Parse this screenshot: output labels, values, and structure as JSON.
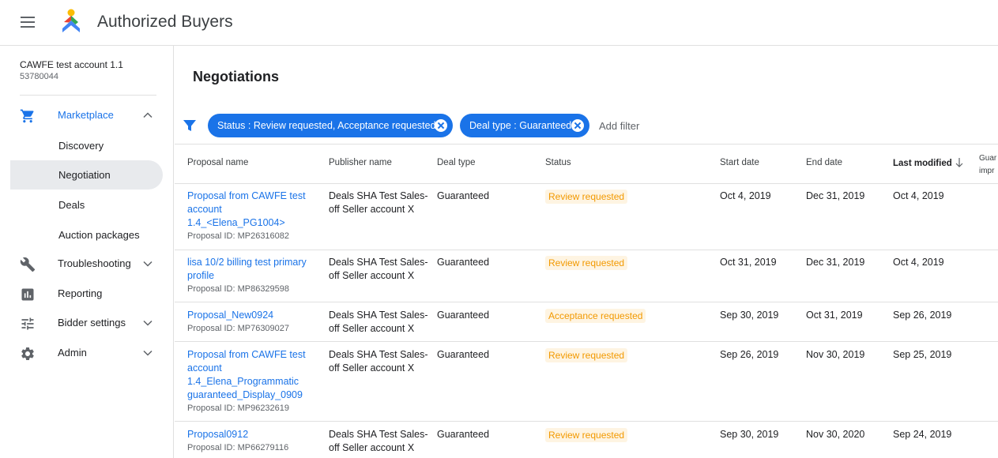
{
  "header": {
    "app_title": "Authorized Buyers"
  },
  "account": {
    "name": "CAWFE test account 1.1",
    "id": "53780044"
  },
  "nav": {
    "marketplace": "Marketplace",
    "discovery": "Discovery",
    "negotiation": "Negotiation",
    "deals": "Deals",
    "auction_packages": "Auction packages",
    "troubleshooting": "Troubleshooting",
    "reporting": "Reporting",
    "bidder_settings": "Bidder settings",
    "admin": "Admin"
  },
  "page": {
    "title": "Negotiations"
  },
  "filters": {
    "chips": [
      "Status : Review requested, Acceptance requested",
      "Deal type : Guaranteed"
    ],
    "add_filter": "Add filter"
  },
  "table": {
    "columns": {
      "proposal_name": "Proposal name",
      "publisher_name": "Publisher name",
      "deal_type": "Deal type",
      "status": "Status",
      "start_date": "Start date",
      "end_date": "End date",
      "last_modified": "Last modified",
      "guaranteed_impressions": "Guar impr"
    },
    "rows": [
      {
        "name_lines": [
          "Proposal from CAWFE test",
          "account",
          "1.4_<Elena_PG1004>"
        ],
        "proposal_id": "Proposal ID: MP26316082",
        "publisher_lines": [
          "Deals SHA Test Sales-",
          "off Seller account X"
        ],
        "deal_type": "Guaranteed",
        "status": "Review requested",
        "start_date": "Oct 4, 2019",
        "end_date": "Dec 31, 2019",
        "last_modified": "Oct 4, 2019"
      },
      {
        "name_lines": [
          "lisa 10/2 billing test primary",
          "profile"
        ],
        "proposal_id": "Proposal ID: MP86329598",
        "publisher_lines": [
          "Deals SHA Test Sales-",
          "off Seller account X"
        ],
        "deal_type": "Guaranteed",
        "status": "Review requested",
        "start_date": "Oct 31, 2019",
        "end_date": "Dec 31, 2019",
        "last_modified": "Oct 4, 2019"
      },
      {
        "name_lines": [
          "Proposal_New0924"
        ],
        "proposal_id": "Proposal ID: MP76309027",
        "publisher_lines": [
          "Deals SHA Test Sales-",
          "off Seller account X"
        ],
        "deal_type": "Guaranteed",
        "status": "Acceptance requested",
        "start_date": "Sep 30, 2019",
        "end_date": "Oct 31, 2019",
        "last_modified": "Sep 26, 2019"
      },
      {
        "name_lines": [
          "Proposal from CAWFE test",
          "account",
          "1.4_Elena_Programmatic",
          "guaranteed_Display_0909"
        ],
        "proposal_id": "Proposal ID: MP96232619",
        "publisher_lines": [
          "Deals SHA Test Sales-",
          "off Seller account X"
        ],
        "deal_type": "Guaranteed",
        "status": "Review requested",
        "start_date": "Sep 26, 2019",
        "end_date": "Nov 30, 2019",
        "last_modified": "Sep 25, 2019"
      },
      {
        "name_lines": [
          "Proposal0912"
        ],
        "proposal_id": "Proposal ID: MP66279116",
        "publisher_lines": [
          "Deals SHA Test Sales-",
          "off Seller account X"
        ],
        "deal_type": "Guaranteed",
        "status": "Review requested",
        "start_date": "Sep 30, 2019",
        "end_date": "Nov 30, 2020",
        "last_modified": "Sep 24, 2019"
      }
    ]
  },
  "colors": {
    "accent": "#1a73e8",
    "status_text": "#f29900",
    "status_bg": "#fef4e2",
    "selected_nav_bg": "#e8eaed"
  },
  "icons": {
    "menu": "menu-icon",
    "logo": "authorized-buyers-logo",
    "marketplace": "cart-icon",
    "troubleshooting": "wrench-icon",
    "reporting": "bar-chart-icon",
    "bidder_settings": "sliders-icon",
    "admin": "gear-icon",
    "filter": "filter-icon",
    "sort": "arrow-down-icon"
  }
}
